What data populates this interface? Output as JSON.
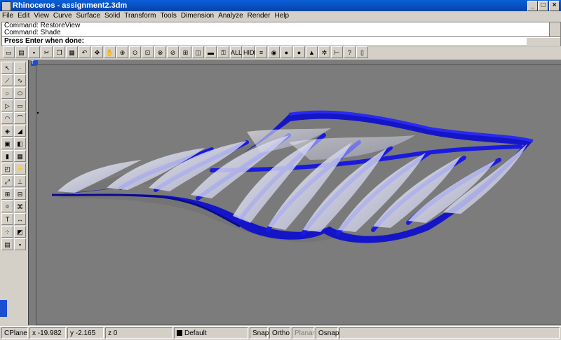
{
  "window": {
    "title": "Rhinoceros - assignment2.3dm"
  },
  "menu": [
    "File",
    "Edit",
    "View",
    "Curve",
    "Surface",
    "Solid",
    "Transform",
    "Tools",
    "Dimension",
    "Analyze",
    "Render",
    "Help"
  ],
  "command_history": [
    "Command: RestoreView",
    "Command: Shade"
  ],
  "prompt": "Press Enter when done:",
  "toolbar_text": {
    "all": "ALL",
    "hide": "HIDE"
  },
  "viewport_tab": "T",
  "status": {
    "cplane": "CPlane",
    "x": "x -19.982",
    "y": "y -2.165",
    "z": "z 0",
    "layer": "Default",
    "snap": "Snap",
    "ortho": "Ortho",
    "planar": "Planar",
    "osnap": "Osnap"
  },
  "colors": {
    "model_blue": "#1a1adf",
    "surface_white": "#e8e8f0",
    "viewport_bg": "#7c7c7c"
  }
}
